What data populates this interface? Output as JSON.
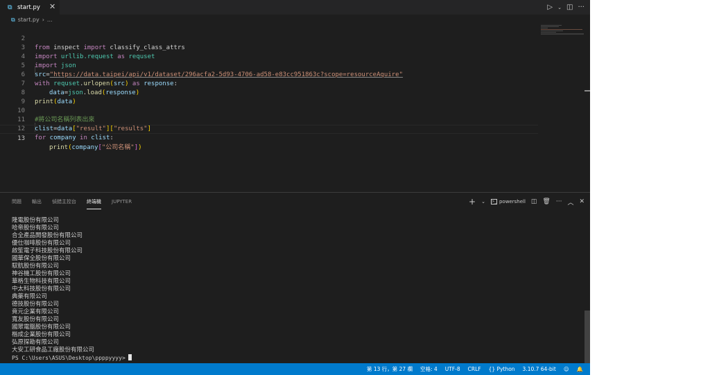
{
  "tab": {
    "title": "start.py",
    "icon": "python-icon"
  },
  "breadcrumb": {
    "file": "start.py",
    "more": "..."
  },
  "editor": {
    "current_line": 13,
    "line_numbers": [
      "2",
      "3",
      "4",
      "5",
      "6",
      "7",
      "8",
      "9",
      "10",
      "11",
      "12",
      "13"
    ],
    "tokens": {
      "l2": [
        "from",
        " inspect ",
        "import",
        " classify_class_attrs"
      ],
      "l3": [
        "import",
        " urllib.request ",
        "as",
        " requset"
      ],
      "l4": [
        "import",
        " json"
      ],
      "l5": [
        "src",
        "=",
        "\"https://data.taipei/api/v1/dataset/296acfa2-5d93-4706-ad58-e83cc951863c?scope=resourceAquire\""
      ],
      "l6": [
        "with",
        " requset",
        ".",
        "urlopen",
        "(",
        "src",
        ")",
        " as ",
        "response",
        ":"
      ],
      "l7": [
        "data",
        "=",
        "json",
        ".",
        "load",
        "(",
        "response",
        ")"
      ],
      "l8": [
        "print",
        "(",
        "data",
        ")"
      ],
      "l10": [
        "#將公司名稱列表出來"
      ],
      "l11": [
        "clist",
        "=",
        "data",
        "[",
        "\"result\"",
        "]",
        "[",
        "\"results\"",
        "]"
      ],
      "l12": [
        "for",
        " company ",
        "in",
        " clist",
        ":"
      ],
      "l13": [
        "print",
        "(",
        "company",
        "[",
        "\"公司名稱\"",
        "]",
        ")"
      ]
    }
  },
  "panel": {
    "tabs": [
      "問題",
      "輸出",
      "偵錯主控台",
      "終端機",
      "JUPYTER"
    ],
    "active_tab": "終端機",
    "shell": "powershell"
  },
  "terminal": {
    "lines": [
      "隆電股份有限公司",
      "哈帝股份有限公司",
      "合全產品開發股份有限公司",
      "優仕咖啡股份有限公司",
      "啟笙電子科技股份有限公司",
      "國華保全股份有限公司",
      "馭航股份有限公司",
      "神谷機工股份有限公司",
      "華格生物科技有限公司",
      "中太科技股份有限公司",
      "典藥有限公司",
      "德技股份有限公司",
      "竟元企業有限公司",
      "寬友股份有限公司",
      "國眾電腦股份有限公司",
      "楷成企業股份有限公司",
      "弘原探勘有限公司",
      "大安工研食品工廠股份有限公司"
    ],
    "prompt": "PS C:\\Users\\ASUS\\Desktop\\ppppyyyy>"
  },
  "status": {
    "position": "第 13 行，第 27 欄",
    "spaces": "空格: 4",
    "encoding": "UTF-8",
    "eol": "CRLF",
    "language": "Python",
    "interpreter": "3.10.7 64-bit"
  },
  "colors": {
    "editor_bg": "#1e1e1e",
    "statusbar_bg": "#007acc",
    "keyword": "#c586c0",
    "string": "#ce9178",
    "comment": "#6a9955"
  }
}
